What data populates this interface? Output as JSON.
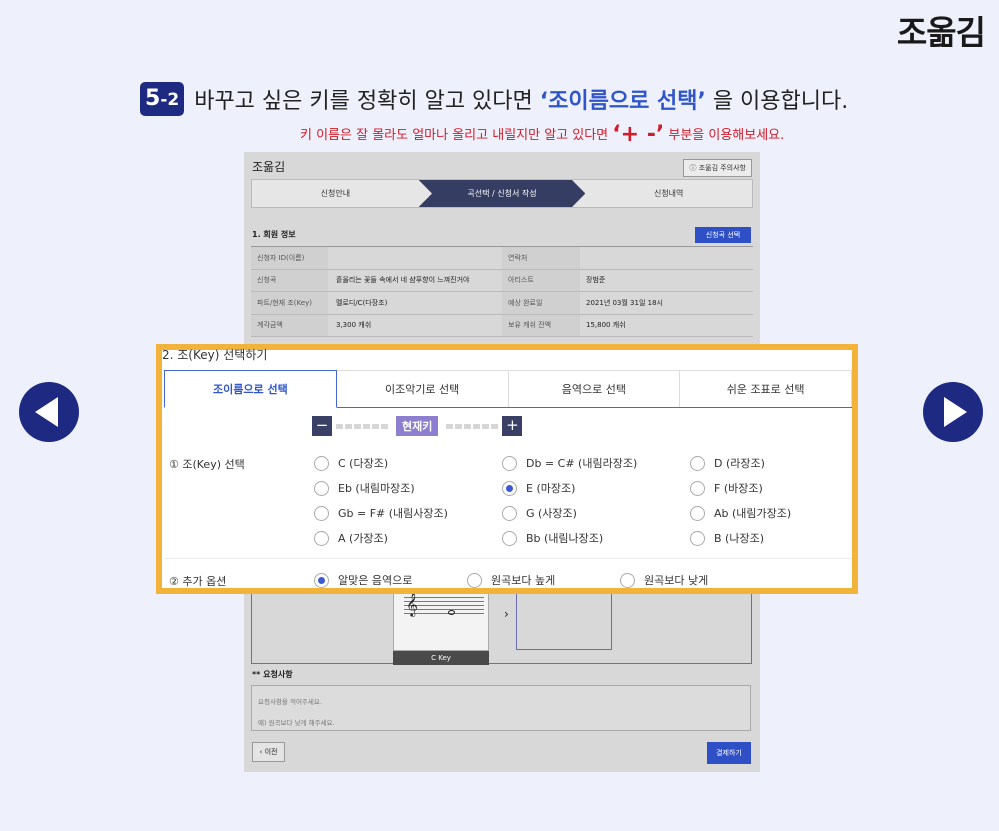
{
  "brand": "조옮김",
  "step": {
    "badge_main": "5",
    "badge_sub": "-2",
    "text_before": "바꾸고 싶은 키를 정확히 알고 있다면 ",
    "highlight": "‘조이름으로 선택’",
    "text_after": " 을 이용합니다."
  },
  "note": {
    "before": "키 이름은 잘 몰라도 얼마나 올리고 내릴지만 알고 있다면 ",
    "symbol": "‘+ -’",
    "after": " 부분을 이용해보세요."
  },
  "background": {
    "title": "조옮김",
    "notice": "조옮김 주의사항",
    "steps": [
      "신청안내",
      "곡선택 / 신청서 작성",
      "신청내역"
    ],
    "section": "1. 회원 정보",
    "select_song_button": "신청곡 선택",
    "rows": [
      {
        "k": "신청자 ID(이름)",
        "v": "",
        "k2": "연락처",
        "v2": ""
      },
      {
        "k": "신청곡",
        "v": "흩올리는 꽃들 속에서 네 샴푸향이 느껴진거야",
        "k2": "아티스트",
        "v2": "장범준"
      },
      {
        "k": "파트/현재 조(Key)",
        "v": "멜로디/C(다장조)",
        "k2": "예상 완료일",
        "v2": "2021년 03월 31일 18시"
      },
      {
        "k": "계각금액",
        "v": "3,300 캐쉬",
        "k2": "보유 캐쉬 잔액",
        "v2": "15,800 캐쉬"
      }
    ],
    "ckey_label": "C Key",
    "chevron": "›",
    "request_label": "** 요청사항",
    "request_placeholder_1": "요청사항을 적어주세요.",
    "request_placeholder_2": "예) 원곡보다 낮게 해주세요.",
    "prev_button": "‹ 이전",
    "pay_button": "결제하기"
  },
  "panel": {
    "heading": "2. 조(Key) 선택하기",
    "tabs": [
      "조이름으로 선택",
      "이조악기로 선택",
      "음역으로 선택",
      "쉬운 조표로 선택"
    ],
    "minus": "−",
    "plus": "+",
    "current_key": "현재키",
    "key_label": "① 조(Key) 선택",
    "keys": [
      "C (다장조)",
      "Db = C# (내림라장조)",
      "D (라장조)",
      "Eb (내림마장조)",
      "E (마장조)",
      "F (바장조)",
      "Gb = F# (내림사장조)",
      "G (사장조)",
      "Ab (내림가장조)",
      "A (가장조)",
      "Bb (내림나장조)",
      "B (나장조)"
    ],
    "selected_key": "E (마장조)",
    "extra_label": "② 추가 옵션",
    "extras": [
      "알맞은 음역으로",
      "원곡보다 높게",
      "원곡보다 낮게"
    ],
    "selected_extra": "알맞은 음역으로"
  },
  "colors": {
    "navy": "#1e2a82",
    "accent_blue": "#2f55c9",
    "note_red": "#d01d2b",
    "highlight_border": "#f2b33a",
    "current_key_purple": "#8e7ecf"
  }
}
